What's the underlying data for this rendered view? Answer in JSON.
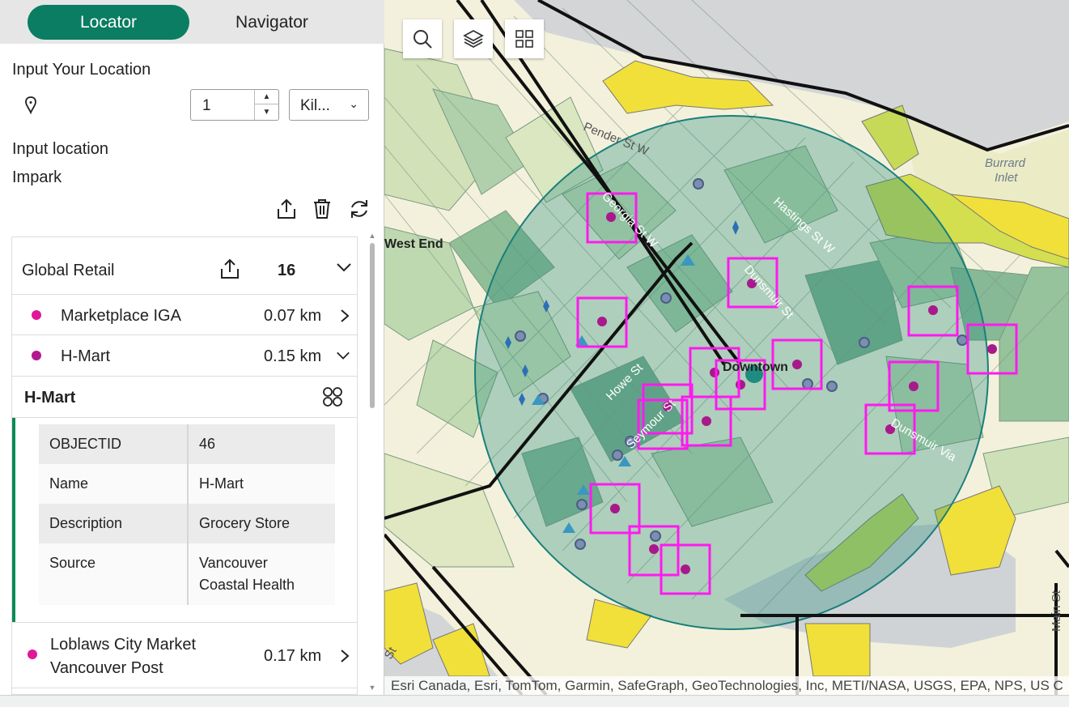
{
  "tabs": {
    "locator": "Locator",
    "navigator": "Navigator"
  },
  "input": {
    "title": "Input Your Location",
    "distance_value": "1",
    "unit_value": "Kil...",
    "location_label": "Input location",
    "location_value": "Impark"
  },
  "results": {
    "layer_title": "Global Retail",
    "layer_count": "16",
    "items": [
      {
        "name": "Marketplace IGA",
        "distance": "0.07 km",
        "color": "#e0179b"
      },
      {
        "name": "H-Mart",
        "distance": "0.15 km",
        "color": "#b5198f"
      },
      {
        "name_line1": "Loblaws City Market",
        "name_line2": "Vancouver Post",
        "distance": "0.17 km",
        "color": "#e0179b"
      }
    ],
    "detail": {
      "title": "H-Mart",
      "rows": [
        {
          "field": "OBJECTID",
          "value": "46"
        },
        {
          "field": "Name",
          "value": "H-Mart"
        },
        {
          "field": "Description",
          "value": "Grocery Store"
        },
        {
          "field": "Source",
          "value_line1": "Vancouver",
          "value_line2": "Coastal Health"
        }
      ]
    }
  },
  "map": {
    "labels": {
      "west_end": "West End",
      "pender": "Pender St W",
      "georgia": "Georgia St W",
      "hastings": "Hastings St W",
      "dunsmuir_st": "Dunsmuir St",
      "howe": "Howe St",
      "seymour": "Seymour St",
      "downtown": "Downtown",
      "dunsmuir_via": "Dunsmuir Via",
      "burrard_1": "Burrard",
      "burrard_2": "Inlet",
      "main": "Main St",
      "st": "St"
    },
    "attribution": "Esri Canada, Esri, TomTom, Garmin, SafeGraph, GeoTechnologies, Inc, METI/NASA, USGS, EPA, NPS, US C",
    "colors": {
      "water": "#d3d5d7",
      "land": "#f3f1dc",
      "circle_fill": "#2e8f7e",
      "highlight": "#ff19f0",
      "poi": "#a8198c",
      "accent": "#0a7d62"
    }
  }
}
